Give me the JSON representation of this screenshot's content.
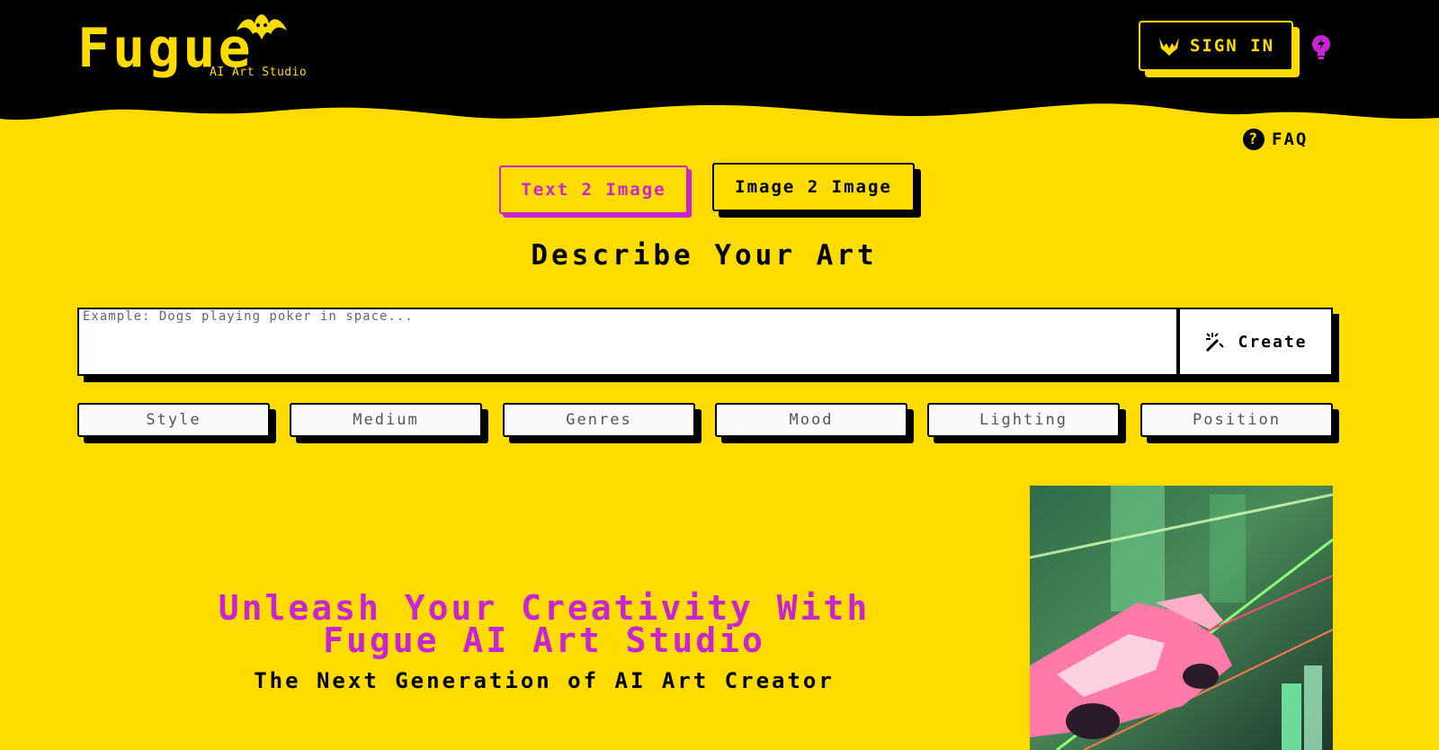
{
  "brand": {
    "name": "Fugue",
    "tagline": "AI Art Studio",
    "color_yellow": "#FFDC00",
    "color_black": "#000000",
    "color_magenta": "#C724D4"
  },
  "header": {
    "signin_label": "SIGN IN",
    "signin_icon": "bat-icon",
    "bulb_icon": "lightbulb-icon"
  },
  "faq": {
    "label": "FAQ",
    "icon": "question-circle-icon"
  },
  "tabs": [
    {
      "label": "Text 2 Image",
      "active": true
    },
    {
      "label": "Image 2 Image",
      "active": false
    }
  ],
  "prompt": {
    "heading": "Describe Your Art",
    "placeholder": "Example: Dogs playing poker in space...",
    "value": "",
    "create_label": "Create",
    "create_icon": "magic-wand-icon"
  },
  "modifiers": [
    "Style",
    "Medium",
    "Genres",
    "Mood",
    "Lighting",
    "Position"
  ],
  "hero": {
    "title_line1": "Unleash Your Creativity With",
    "title_line2": "Fugue AI Art Studio",
    "subtitle": "The Next Generation of AI Art Creator"
  }
}
